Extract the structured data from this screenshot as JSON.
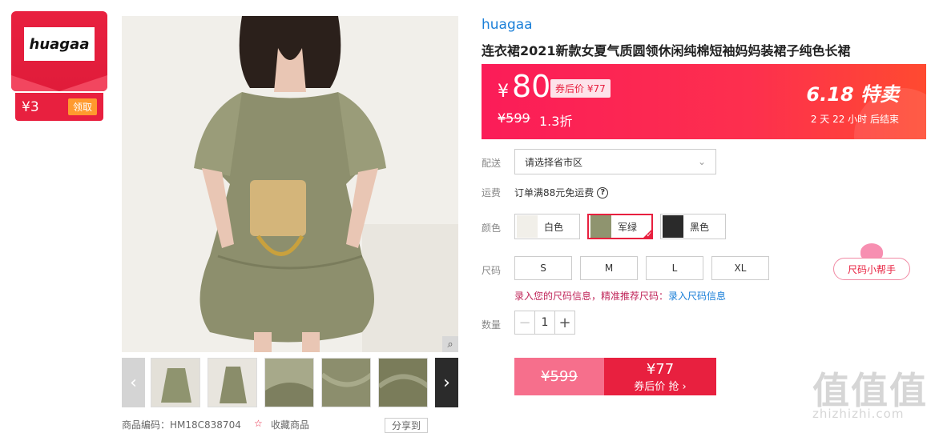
{
  "shop_badge": {
    "logo": "huagaa",
    "coupon_amount": "¥3",
    "claim_label": "领取"
  },
  "product": {
    "shop_name": "huagaa",
    "title": "连衣裙2021新款女夏气质圆领休闲纯棉短袖妈妈装裙子纯色长裙"
  },
  "price": {
    "currency": "¥",
    "current": "80",
    "after_coupon": "券后价 ¥77",
    "original": "¥599",
    "discount": "1.3折",
    "promo_title": "6.18 特卖",
    "countdown": "2 天 22 小时 后结束"
  },
  "delivery": {
    "label": "配送",
    "placeholder": "请选择省市区"
  },
  "shipping": {
    "label": "运费",
    "text": "订单满88元免运费"
  },
  "colors": {
    "label": "颜色",
    "options": [
      {
        "name": "白色",
        "swatch": "#f1efe9"
      },
      {
        "name": "军绿",
        "swatch": "#8f946f"
      },
      {
        "name": "黑色",
        "swatch": "#2a2a2a"
      }
    ],
    "selected": "军绿"
  },
  "sizes": {
    "label": "尺码",
    "options": [
      "S",
      "M",
      "L",
      "XL"
    ],
    "helper": "尺码小帮手"
  },
  "size_info": {
    "prefix": "录入您的尺码信息，精准推荐尺码：",
    "link": "录入尺码信息"
  },
  "quantity": {
    "label": "数量",
    "value": "1",
    "minus": "−",
    "plus": "+"
  },
  "buy": {
    "original": "¥599",
    "coupon_price": "¥77",
    "coupon_action": "券后价 抢 ›"
  },
  "watermark": {
    "main": "值值值",
    "sub": "zhizhizhi.com"
  },
  "below_thumbs": {
    "code": "商品编码：HM18C838704",
    "favorite": "收藏商品",
    "share": "分享到"
  }
}
